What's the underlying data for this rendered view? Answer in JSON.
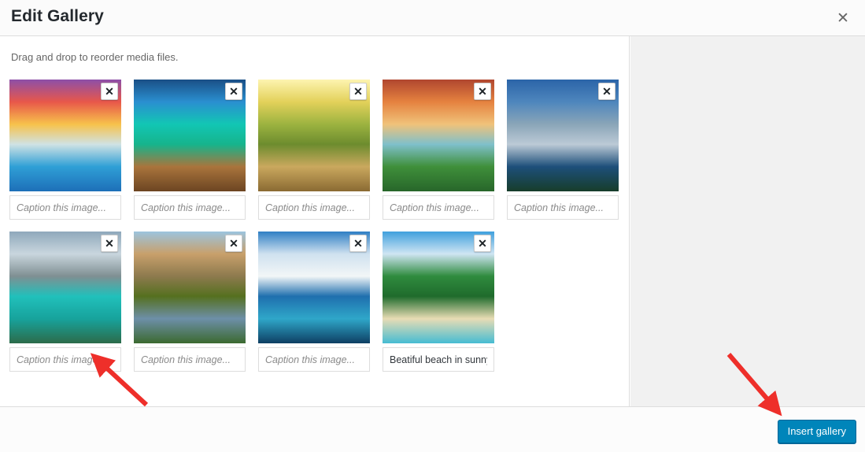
{
  "header": {
    "title": "Edit Gallery",
    "close_icon": "close-icon",
    "close_glyph": "✕"
  },
  "content": {
    "instructions": "Drag and drop to reorder media files.",
    "remove_glyph": "✕",
    "caption_placeholder": "Caption this image...",
    "items": [
      {
        "index": 1,
        "alt": "Sunset over ocean waterfall with purple sky",
        "caption": "",
        "placeholder": "Caption this image...",
        "remove_label": "Remove",
        "colors": [
          "#8d4fa8",
          "#e8574a",
          "#f7c24b",
          "#cfe2e4",
          "#2f9fd6",
          "#1d6fb8"
        ]
      },
      {
        "index": 2,
        "alt": "Wooden pier over turquoise tropical water",
        "caption": "",
        "placeholder": "Caption this image...",
        "remove_label": "Remove",
        "colors": [
          "#1a4f86",
          "#2a8fd0",
          "#12c6b4",
          "#16b48c",
          "#a9743c",
          "#6c4522"
        ]
      },
      {
        "index": 3,
        "alt": "Sunbeams through green forest path",
        "caption": "",
        "placeholder": "Caption this image...",
        "remove_label": "Remove",
        "colors": [
          "#fdf4b0",
          "#e3d15a",
          "#9cb340",
          "#6d8c2e",
          "#caa85e",
          "#8a6a33"
        ]
      },
      {
        "index": 4,
        "alt": "Green island mountain at sunrise with river",
        "caption": "",
        "placeholder": "Caption this image...",
        "remove_label": "Remove",
        "colors": [
          "#b0462f",
          "#e5823f",
          "#f0c27a",
          "#7fc0cb",
          "#3f8f3a",
          "#27662a"
        ]
      },
      {
        "index": 5,
        "alt": "Snowy mountains reflected in blue lake",
        "caption": "",
        "placeholder": "Caption this image...",
        "remove_label": "Remove",
        "colors": [
          "#2b64a8",
          "#4e86bd",
          "#8aa5b8",
          "#bccad6",
          "#1d4f7a",
          "#173d2a"
        ]
      },
      {
        "index": 6,
        "alt": "Moraine lake with turquoise water and pines",
        "caption": "",
        "placeholder": "Caption this image...",
        "remove_label": "Remove",
        "colors": [
          "#8fa8bb",
          "#c9d6de",
          "#7f8f92",
          "#21c0bb",
          "#17a39c",
          "#2c6b4a"
        ]
      },
      {
        "index": 7,
        "alt": "Mountain reflected in calm lake with forest",
        "caption": "",
        "placeholder": "Caption this image...",
        "remove_label": "Remove",
        "colors": [
          "#9cc4de",
          "#c8a06b",
          "#8d7a4e",
          "#55701f",
          "#6d8fa8",
          "#3c6a30"
        ]
      },
      {
        "index": 8,
        "alt": "Aerial view of whitehaven beach and blue sea",
        "caption": "",
        "placeholder": "Caption this image...",
        "remove_label": "Remove",
        "colors": [
          "#2f7fc4",
          "#cfe1ef",
          "#f2f6f7",
          "#1f6fae",
          "#2fa7c9",
          "#0e3f63"
        ]
      },
      {
        "index": 9,
        "alt": "Palm tree on sunny tropical beach",
        "caption": "Beatiful beach in sunny",
        "placeholder": "Caption this image...",
        "remove_label": "Remove",
        "colors": [
          "#3fa0dd",
          "#cfe5f3",
          "#2f8b3e",
          "#1f6b2c",
          "#e8dcb4",
          "#46bcd2"
        ]
      }
    ]
  },
  "footer": {
    "insert_gallery_label": "Insert gallery"
  },
  "annotations": {
    "arrow_color": "#ee2f2a",
    "arrow_caption_target": "caption-input-row2-item1",
    "arrow_insert_target": "insert-gallery-button"
  }
}
